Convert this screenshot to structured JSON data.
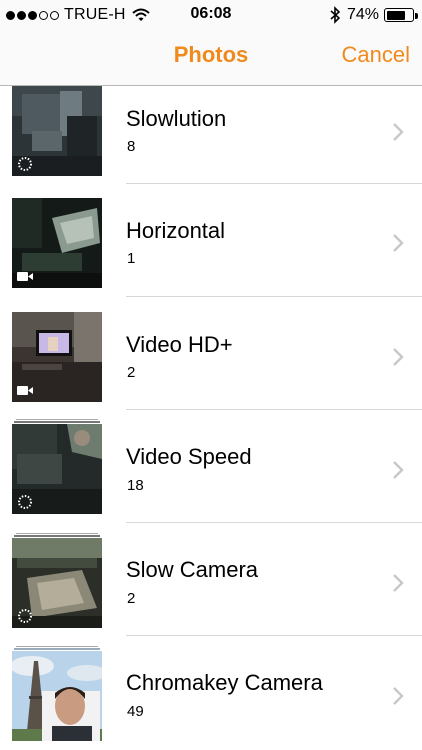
{
  "status_bar": {
    "carrier": "TRUE-H",
    "time": "06:08",
    "battery": "74%",
    "battery_level": 0.74,
    "signal_bars_filled": 3,
    "signal_bars_total": 5,
    "icons": [
      "wifi-icon",
      "bluetooth-icon",
      "battery-icon"
    ]
  },
  "nav": {
    "title": "Photos",
    "cancel_label": "Cancel"
  },
  "colors": {
    "accent": "#f08a1c"
  },
  "albums": [
    {
      "title": "Slowlution",
      "count": "8",
      "badge": "slow-motion-icon"
    },
    {
      "title": "Horizontal",
      "count": "1",
      "badge": "video-camera-icon"
    },
    {
      "title": "Video HD+",
      "count": "2",
      "badge": "video-camera-icon"
    },
    {
      "title": "Video Speed",
      "count": "18",
      "badge": "slow-motion-icon"
    },
    {
      "title": "Slow Camera",
      "count": "2",
      "badge": "slow-motion-icon"
    },
    {
      "title": "Chromakey Camera",
      "count": "49",
      "badge": ""
    }
  ]
}
